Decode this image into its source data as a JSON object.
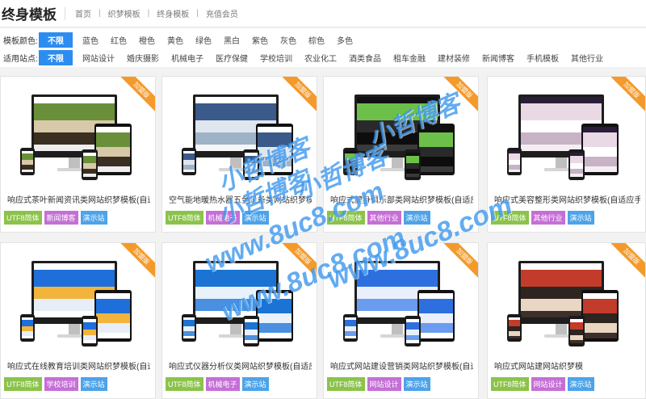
{
  "header": {
    "title": "终身模板",
    "breadcrumbs": [
      "首页",
      "织梦模板",
      "终身模板",
      "充值会员"
    ],
    "separator": "|"
  },
  "filters": {
    "color": {
      "label": "模板颜色:",
      "options": [
        "不限",
        "蓝色",
        "红色",
        "橙色",
        "黄色",
        "绿色",
        "黑白",
        "紫色",
        "灰色",
        "棕色",
        "多色"
      ],
      "active": "不限"
    },
    "site": {
      "label": "适用站点:",
      "options": [
        "不限",
        "网站设计",
        "婚庆摄影",
        "机械电子",
        "医疗保健",
        "学校培训",
        "农业化工",
        "酒类食品",
        "租车金融",
        "建材装修",
        "新闻博客",
        "手机模板",
        "其他行业"
      ],
      "active": "不限"
    }
  },
  "cards": [
    {
      "title": "响应式茶叶新闻资讯类网站织梦模板(自适",
      "ribbon": "加盟版",
      "tags": [
        "UTF8简体",
        "新闻博客",
        "演示站"
      ],
      "theme": "tea"
    },
    {
      "title": "空气能地暖热水器五金设备类网站织梦模板",
      "ribbon": "加盟版",
      "tags": [
        "UTF8简体",
        "机械电子",
        "演示站"
      ],
      "theme": "bath"
    },
    {
      "title": "响应式健身俱乐部类网站织梦模板(自适应",
      "ribbon": "加盟版",
      "tags": [
        "UTF8简体",
        "其他行业",
        "演示站"
      ],
      "theme": "gym"
    },
    {
      "title": "响应式美容整形类网站织梦模板(自适应手",
      "ribbon": "加盟版",
      "tags": [
        "UTF8简体",
        "其他行业",
        "演示站"
      ],
      "theme": "beauty"
    },
    {
      "title": "响应式在线教育培训类网站织梦模板(自适",
      "ribbon": "加盟版",
      "tags": [
        "UTF8简体",
        "学校培训",
        "演示站"
      ],
      "theme": "edu"
    },
    {
      "title": "响应式仪器分析仪类网站织梦模板(自适应",
      "ribbon": "加盟版",
      "tags": [
        "UTF8简体",
        "机械电子",
        "演示站"
      ],
      "theme": "instrument"
    },
    {
      "title": "响应式网站建设营销类网站织梦模板(自适",
      "ribbon": "加盟版",
      "tags": [
        "UTF8简体",
        "网站设计",
        "演示站"
      ],
      "theme": "webdev"
    },
    {
      "title": "响应式网站建网站织梦模",
      "ribbon": "加盟版",
      "tags": [
        "UTF8简体",
        "网站设计",
        "演示站"
      ],
      "theme": "food"
    }
  ],
  "watermarks": [
    "小哲博客",
    "小哲博客",
    "小哲博客",
    "小哲博客",
    "www.8uc8.com",
    "www.8uc8.com",
    "www.8uc8.com"
  ],
  "colors": {
    "accent": "#2d8cf0",
    "ribbon": "#f39a2b",
    "tag_utf": "#8bc34a",
    "tag_category": "#c56fd6",
    "tag_demo": "#4da3ea",
    "watermark": "#288ceb"
  }
}
